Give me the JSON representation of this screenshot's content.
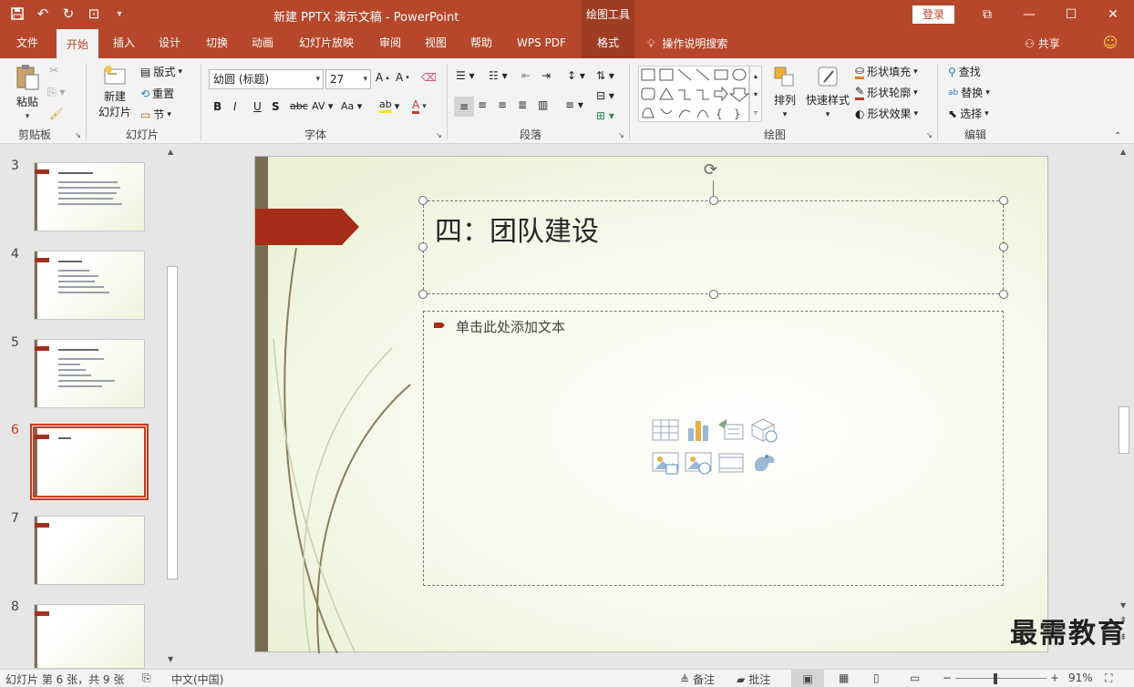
{
  "window": {
    "doc_title": "新建 PPTX 演示文稿  -  PowerPoint",
    "context_tools": "绘图工具",
    "login": "登录",
    "share": "共享"
  },
  "tabs": [
    "文件",
    "开始",
    "插入",
    "设计",
    "切换",
    "动画",
    "幻灯片放映",
    "审阅",
    "视图",
    "帮助",
    "WPS PDF",
    "格式"
  ],
  "active_tab": "开始",
  "tell_me": "操作说明搜索",
  "ribbon": {
    "clipboard": {
      "label": "剪贴板",
      "paste": "粘贴"
    },
    "slides": {
      "label": "幻灯片",
      "new_slide_1": "新建",
      "new_slide_2": "幻灯片",
      "layout": "版式",
      "reset": "重置",
      "section": "节"
    },
    "font": {
      "label": "字体",
      "font_name": "幼圆 (标题)",
      "font_size": "27"
    },
    "paragraph": {
      "label": "段落"
    },
    "drawing": {
      "label": "绘图",
      "arrange": "排列",
      "quick_styles": "快速样式",
      "shape_fill": "形状填充",
      "shape_outline": "形状轮廓",
      "shape_effects": "形状效果"
    },
    "editing": {
      "label": "编辑",
      "find": "查找",
      "replace": "替换",
      "select": "选择"
    }
  },
  "thumbnails": [
    {
      "num": "3",
      "title": "",
      "lines": 5,
      "selected": false
    },
    {
      "num": "4",
      "title": "",
      "lines": 5,
      "selected": false
    },
    {
      "num": "5",
      "title": "",
      "lines": 6,
      "selected": false
    },
    {
      "num": "6",
      "title": "",
      "lines": 0,
      "selected": true
    },
    {
      "num": "7",
      "title": "",
      "lines": 0,
      "selected": false
    },
    {
      "num": "8",
      "title": "",
      "lines": 0,
      "selected": false
    }
  ],
  "slide": {
    "title": "四：团队建设",
    "body_placeholder": "单击此处添加文本"
  },
  "status": {
    "slide_info": "幻灯片 第 6 张，共 9 张",
    "language": "中文(中国)",
    "notes": "备注",
    "comments": "批注",
    "zoom": "91%"
  },
  "watermark": "最需教育",
  "colors": {
    "accent": "#b7472a",
    "context": "#9e3d24",
    "selection": "#c43e1c"
  }
}
